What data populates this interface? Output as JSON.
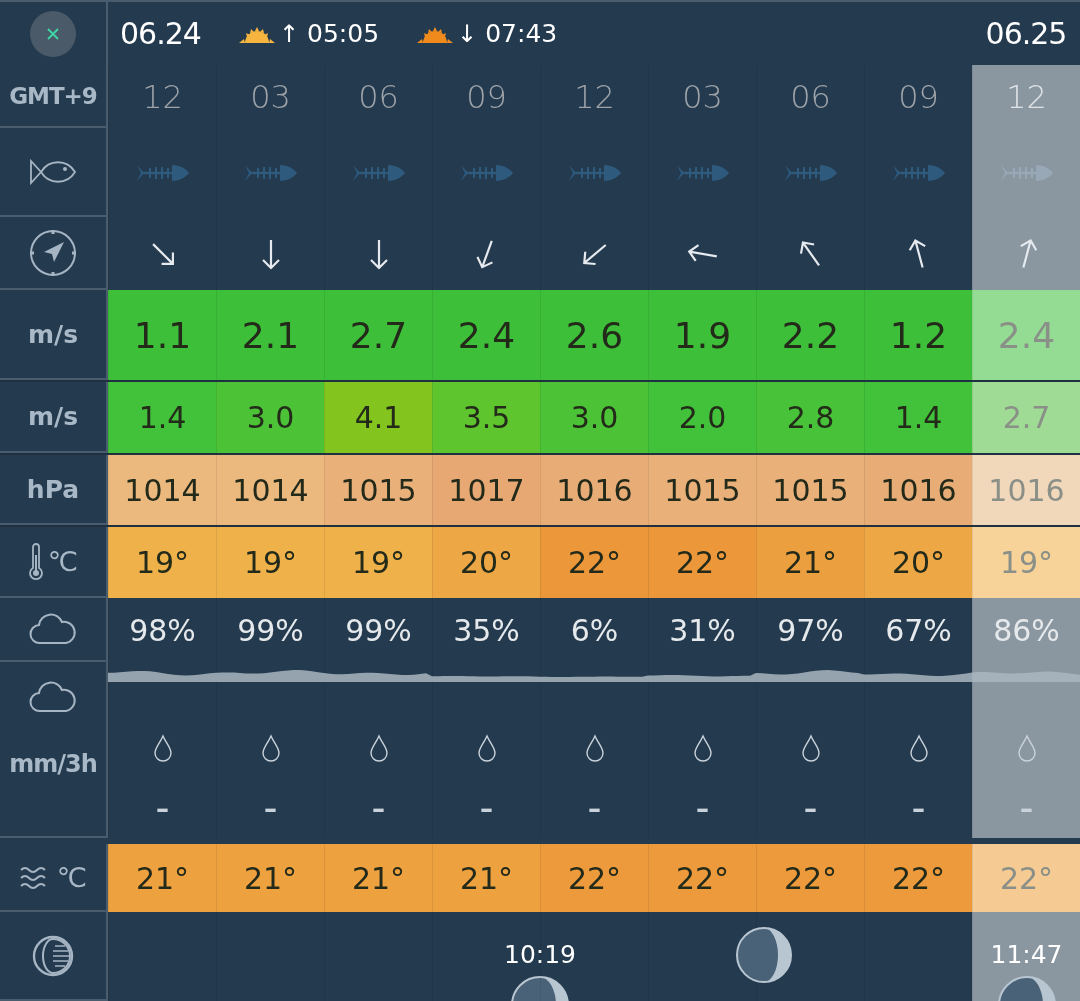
{
  "header": {
    "date": "06.24",
    "sun": [
      {
        "kind": "sunrise",
        "arrow": "↑",
        "time": "05:05"
      },
      {
        "kind": "sunset",
        "arrow": "↓",
        "time": "07:43"
      }
    ],
    "next_date": "06.25"
  },
  "row_labels": {
    "time": "GMT+9",
    "wind": "m/s",
    "gust": "m/s",
    "pressure": "hPa",
    "temperature": "℃",
    "precipitation": "mm/3h",
    "sea_temperature": "℃"
  },
  "columns": [
    {
      "time": "12",
      "dimmed": false,
      "arrow": {
        "kind": "se"
      },
      "wind": "1.1",
      "gust": {
        "value": "1.4",
        "color": "#42c23a"
      },
      "pressure": {
        "value": "1014",
        "color": "#ebb87e"
      },
      "temp": {
        "value": "19°",
        "color": "#efb24a"
      },
      "cloud": "98%",
      "precip": "–",
      "sea_temp": {
        "value": "21°",
        "color": "#eea13f"
      }
    },
    {
      "time": "03",
      "dimmed": false,
      "arrow": {
        "kind": "s"
      },
      "wind": "2.1",
      "gust": {
        "value": "3.0",
        "color": "#4cc236"
      },
      "pressure": {
        "value": "1014",
        "color": "#ebb87e"
      },
      "temp": {
        "value": "19°",
        "color": "#efb24a"
      },
      "cloud": "99%",
      "precip": "–",
      "sea_temp": {
        "value": "21°",
        "color": "#eea13f"
      }
    },
    {
      "time": "06",
      "dimmed": false,
      "arrow": {
        "kind": "s"
      },
      "wind": "2.7",
      "gust": {
        "value": "4.1",
        "color": "#84c41e"
      },
      "pressure": {
        "value": "1015",
        "color": "#e9b07a"
      },
      "temp": {
        "value": "19°",
        "color": "#efb24a"
      },
      "cloud": "99%",
      "precip": "–",
      "sea_temp": {
        "value": "21°",
        "color": "#eea13f"
      }
    },
    {
      "time": "09",
      "dimmed": false,
      "arrow": {
        "kind": "ssw"
      },
      "wind": "2.4",
      "gust": {
        "value": "3.5",
        "color": "#5ec52e"
      },
      "pressure": {
        "value": "1017",
        "color": "#e7a874"
      },
      "temp": {
        "value": "20°",
        "color": "#eda744"
      },
      "cloud": "35%",
      "precip": "–",
      "sea_temp": {
        "value": "21°",
        "color": "#eea13f"
      },
      "moon": {
        "kind": "rise",
        "time": "10:19"
      }
    },
    {
      "time": "12",
      "dimmed": false,
      "arrow": {
        "kind": "sw"
      },
      "wind": "2.6",
      "gust": {
        "value": "3.0",
        "color": "#4cc236"
      },
      "pressure": {
        "value": "1016",
        "color": "#e8ad77"
      },
      "temp": {
        "value": "22°",
        "color": "#eb973a"
      },
      "cloud": "6%",
      "precip": "–",
      "sea_temp": {
        "value": "22°",
        "color": "#ec9a3c"
      }
    },
    {
      "time": "03",
      "dimmed": false,
      "arrow": {
        "kind": "w"
      },
      "wind": "1.9",
      "gust": {
        "value": "2.0",
        "color": "#42c23a"
      },
      "pressure": {
        "value": "1015",
        "color": "#e9b07a"
      },
      "temp": {
        "value": "22°",
        "color": "#eb973a"
      },
      "cloud": "31%",
      "precip": "–",
      "sea_temp": {
        "value": "22°",
        "color": "#ec9a3c"
      }
    },
    {
      "time": "06",
      "dimmed": false,
      "arrow": {
        "kind": "nw"
      },
      "wind": "2.2",
      "gust": {
        "value": "2.8",
        "color": "#48c238"
      },
      "pressure": {
        "value": "1015",
        "color": "#e9b07a"
      },
      "temp": {
        "value": "21°",
        "color": "#ec9f3e"
      },
      "cloud": "97%",
      "precip": "–",
      "sea_temp": {
        "value": "22°",
        "color": "#ec9a3c"
      },
      "moon": {
        "kind": "phase"
      }
    },
    {
      "time": "09",
      "dimmed": false,
      "arrow": {
        "kind": "nnw"
      },
      "wind": "1.2",
      "gust": {
        "value": "1.4",
        "color": "#42c23a"
      },
      "pressure": {
        "value": "1016",
        "color": "#e8ad77"
      },
      "temp": {
        "value": "20°",
        "color": "#eda744"
      },
      "cloud": "67%",
      "precip": "–",
      "sea_temp": {
        "value": "22°",
        "color": "#ec9a3c"
      }
    },
    {
      "time": "12",
      "dimmed": true,
      "arrow": {
        "kind": "nne"
      },
      "wind": "2.4",
      "gust": {
        "value": "2.7",
        "color": "#9fdb94"
      },
      "pressure": {
        "value": "1016",
        "color": "#f2d8bb"
      },
      "temp": {
        "value": "19°",
        "color": "#f7d39a"
      },
      "cloud": "86%",
      "precip": "–",
      "sea_temp": {
        "value": "22°",
        "color": "#f5cb93"
      },
      "moon": {
        "kind": "rise",
        "time": "11:47"
      }
    }
  ]
}
